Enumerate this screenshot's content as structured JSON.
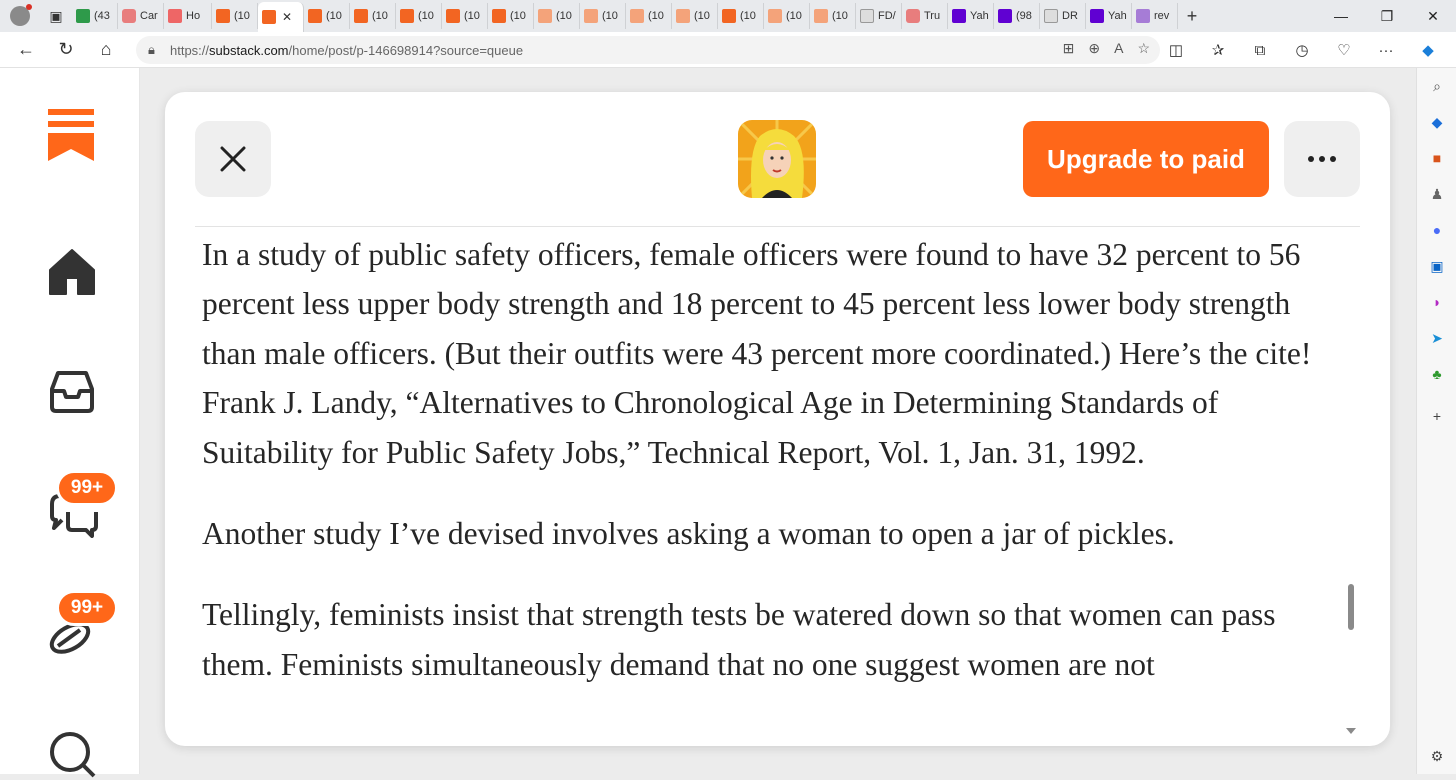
{
  "browser": {
    "tabs": [
      {
        "label": "(43",
        "icon": "grammarly-icon",
        "color": "fav-green"
      },
      {
        "label": "Car",
        "icon": "youtube-icon",
        "color": "fav-yt"
      },
      {
        "label": "Ho",
        "icon": "substack-icon",
        "color": "fav-red"
      },
      {
        "label": "(10",
        "icon": "substack-icon",
        "color": "fav-orange"
      },
      {
        "label": "",
        "icon": "substack-icon",
        "color": "fav-orange",
        "active": true
      },
      {
        "label": "(10",
        "icon": "substack-icon",
        "color": "fav-orange"
      },
      {
        "label": "(10",
        "icon": "substack-icon",
        "color": "fav-orange"
      },
      {
        "label": "(10",
        "icon": "substack-icon",
        "color": "fav-orange"
      },
      {
        "label": "(10",
        "icon": "substack-icon",
        "color": "fav-orange"
      },
      {
        "label": "(10",
        "icon": "substack-icon",
        "color": "fav-orange"
      },
      {
        "label": "(10",
        "icon": "substack-icon",
        "color": "fav-orange-light"
      },
      {
        "label": "(10",
        "icon": "substack-icon",
        "color": "fav-orange-light"
      },
      {
        "label": "(10",
        "icon": "substack-icon",
        "color": "fav-orange-light"
      },
      {
        "label": "(10",
        "icon": "substack-icon",
        "color": "fav-orange-light"
      },
      {
        "label": "(10",
        "icon": "substack-icon",
        "color": "fav-orange"
      },
      {
        "label": "(10",
        "icon": "substack-icon",
        "color": "fav-orange-light"
      },
      {
        "label": "(10",
        "icon": "substack-icon",
        "color": "fav-orange-light"
      },
      {
        "label": "FD/",
        "icon": "document-icon",
        "color": "fav-grey"
      },
      {
        "label": "Tru",
        "icon": "youtube-icon",
        "color": "fav-yt"
      },
      {
        "label": "Yah",
        "icon": "yahoo-icon",
        "color": "fav-purple"
      },
      {
        "label": "(98",
        "icon": "yahoo-mail-icon",
        "color": "fav-purple"
      },
      {
        "label": "DR",
        "icon": "dr-icon",
        "color": "fav-grey"
      },
      {
        "label": "Yah",
        "icon": "yahoo-icon",
        "color": "fav-purple"
      },
      {
        "label": "rev",
        "icon": "yahoo-icon",
        "color": "fav-violet"
      }
    ],
    "url_prefix": "https://",
    "url_host": "substack.com",
    "url_path": "/home/post/p-146698914?source=queue"
  },
  "substack": {
    "nav": {
      "chat_badge": "99+",
      "activity_badge": "99+"
    },
    "header": {
      "upgrade_label": "Upgrade to paid"
    },
    "article": {
      "paragraphs": [
        "In a study of public safety officers, female officers were found to have 32 percent to 56 percent less upper body strength and 18 percent to 45 percent less lower body strength than male officers. (But their outfits were 43 percent more coordinated.) Here’s the cite! Frank J. Landy, “Alternatives to Chronological Age in Determining Standards of Suitability for Public Safety Jobs,” Technical Report, Vol. 1, Jan. 31, 1992.",
        "Another study I’ve devised involves asking a woman to open a jar of pickles.",
        "Tellingly, feminists insist that strength tests be watered down so that women can pass them. Feminists simultaneously demand that no one suggest women are not"
      ]
    },
    "colors": {
      "brand": "#ff6719"
    }
  }
}
